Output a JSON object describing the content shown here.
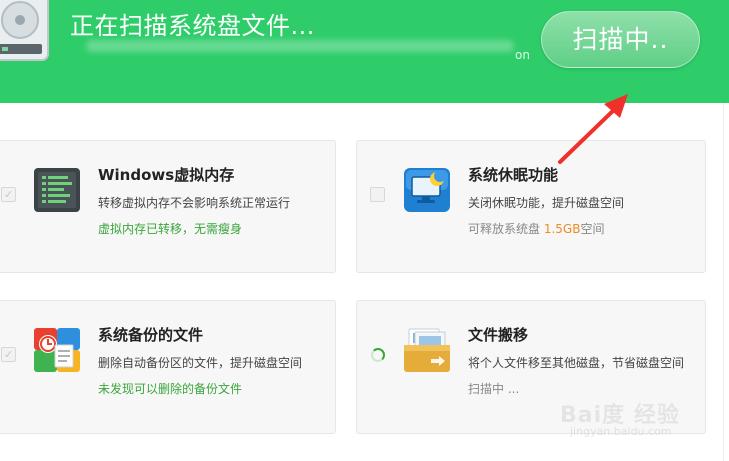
{
  "header": {
    "title": "正在扫描系统盘文件...",
    "path_tail": "on",
    "scan_button_label": "扫描中.."
  },
  "cards": [
    {
      "title": "Windows虚拟内存",
      "desc": "转移虚拟内存不会影响系统正常运行",
      "status": "虚拟内存已转移，无需瘦身",
      "icon": "memory-chip-icon",
      "checked": true
    },
    {
      "title": "系统休眠功能",
      "desc": "关闭休眠功能，提升磁盘空间",
      "status_prefix": "可释放系统盘 ",
      "status_value": "1.5GB",
      "status_suffix": "空间",
      "icon": "monitor-moon-icon",
      "checked": false
    },
    {
      "title": "系统备份的文件",
      "desc": "删除自动备份区的文件，提升磁盘空间",
      "status": "未发现可以删除的备份文件",
      "icon": "backup-files-icon",
      "checked": true
    },
    {
      "title": "文件搬移",
      "desc": "将个人文件移至其他磁盘，节省磁盘空间",
      "status": "扫描中 ...",
      "icon": "folder-move-icon",
      "scanning": true
    }
  ],
  "watermark": {
    "main": "Bai度 经验",
    "sub": "jingyan.baidu.com"
  },
  "colors": {
    "header_green": "#2ecd6a",
    "status_green": "#3aa53c",
    "highlight_orange": "#f08a24",
    "arrow_red": "#f0302a"
  }
}
